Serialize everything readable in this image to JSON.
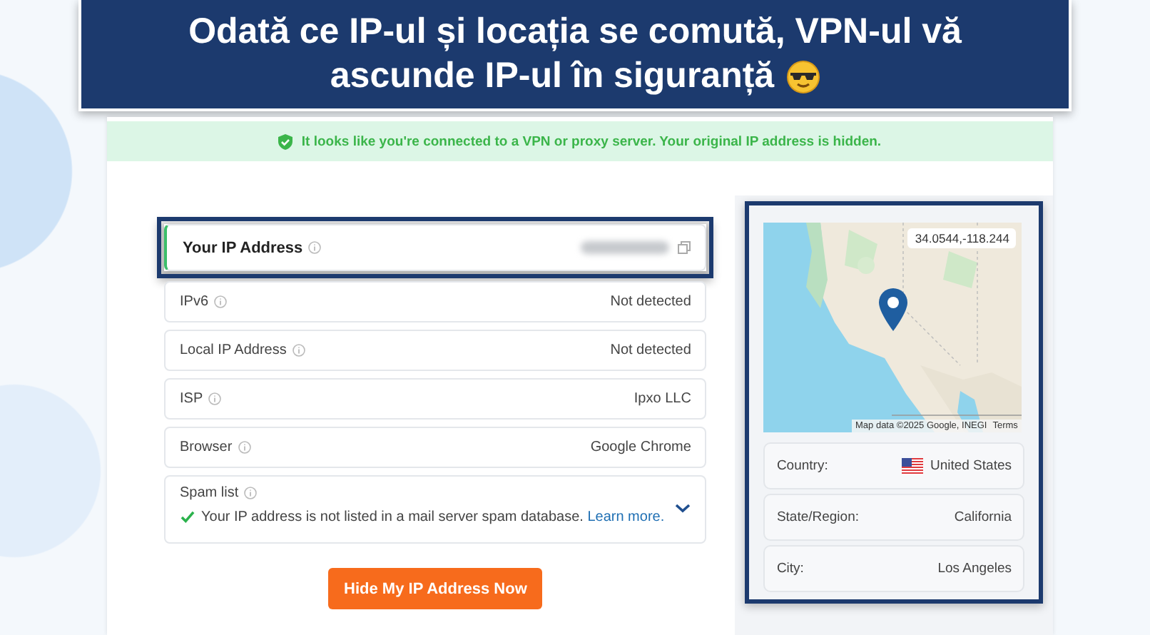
{
  "headline": {
    "lines": [
      "Odată ce IP-ul și locația se comută, VPN-ul vă",
      "ascunde IP-ul în siguranță"
    ]
  },
  "notice": {
    "text": "It looks like you're connected to a VPN or proxy server. Your original IP address is hidden."
  },
  "ip_rows": [
    {
      "kind": "redacted",
      "label": "Your IP Address",
      "highlighted": true
    },
    {
      "kind": "plain",
      "label": "IPv6",
      "value": "Not detected",
      "highlighted": false
    },
    {
      "kind": "plain",
      "label": "Local IP Address",
      "value": "Not detected",
      "highlighted": false
    },
    {
      "kind": "plain",
      "label": "ISP",
      "value": "Ipxo LLC",
      "highlighted": false
    },
    {
      "kind": "plain",
      "label": "Browser",
      "value": "Google Chrome",
      "highlighted": false
    },
    {
      "kind": "spam",
      "label": "Spam list",
      "message": "Your IP address is not listed in a mail server spam database.",
      "link": "Learn more.",
      "expanded": false,
      "highlighted": false
    }
  ],
  "hide_button": "Hide My IP Address Now",
  "location": {
    "highlighted": true,
    "map": {
      "coordinates": "34.0544,-118.244",
      "attribution": "Map data ©2025 Google, INEGI",
      "terms": "Terms"
    },
    "rows": [
      {
        "kind": "flag",
        "label": "Country:",
        "value": "United States"
      },
      {
        "kind": "plain",
        "label": "State/Region:",
        "value": "California"
      },
      {
        "kind": "plain",
        "label": "City:",
        "value": "Los Angeles"
      }
    ]
  }
}
